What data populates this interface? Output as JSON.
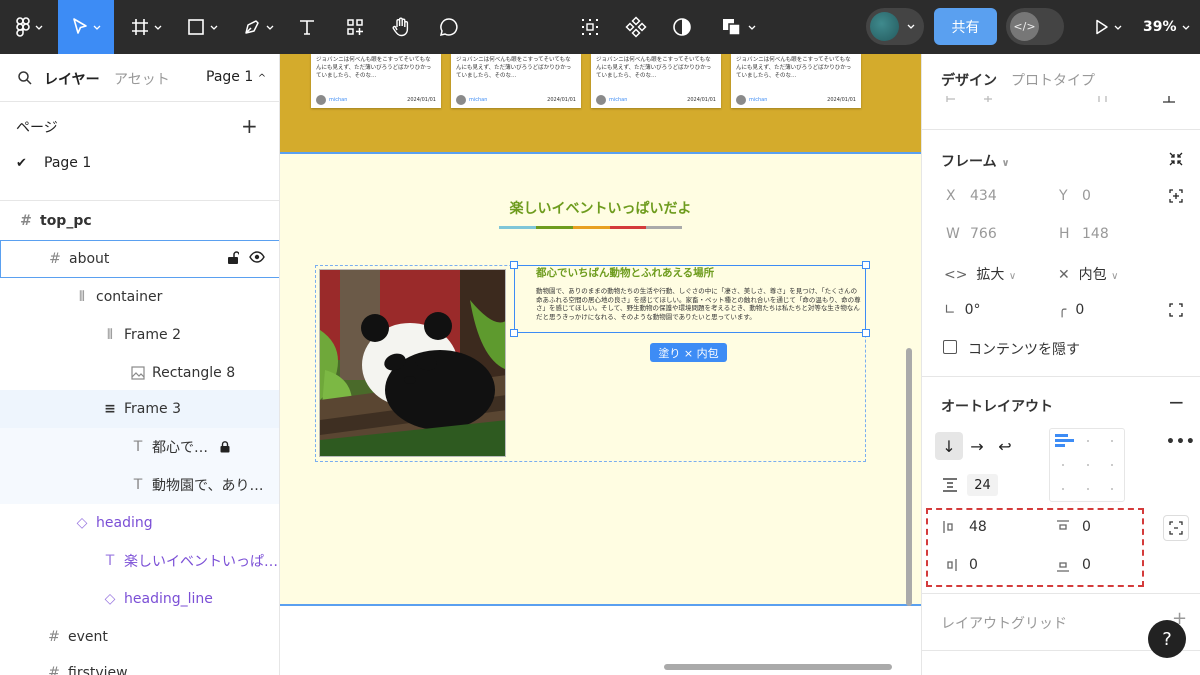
{
  "toolbar": {
    "share_label": "共有",
    "zoom_label": "39%",
    "accent": "#3d8cf5",
    "icons": [
      "figma-menu-icon",
      "move-tool-icon",
      "frame-tool-icon",
      "shape-tool-icon",
      "pen-tool-icon",
      "text-tool-icon",
      "component-tool-icon",
      "hand-tool-icon",
      "comment-tool-icon",
      "grid-icon",
      "component-icon",
      "mask-icon",
      "boolean-icon",
      "play-icon"
    ]
  },
  "left_panel": {
    "tab_layers": "レイヤー",
    "tab_assets": "アセット",
    "page_selector": "Page 1",
    "pages_header": "ページ",
    "pages": [
      "Page 1"
    ],
    "layers": [
      {
        "name": "top_pc",
        "icon": "frame-icon"
      },
      {
        "name": "about",
        "icon": "frame-icon"
      },
      {
        "name": "container",
        "icon": "auto-layout-icon"
      },
      {
        "name": "Frame 2",
        "icon": "auto-layout-icon"
      },
      {
        "name": "Rectangle 8",
        "icon": "image-icon"
      },
      {
        "name": "Frame 3",
        "icon": "auto-layout-vertical-icon"
      },
      {
        "name": "都心で…",
        "icon": "text-icon"
      },
      {
        "name": "動物園で、あり…",
        "icon": "text-icon"
      },
      {
        "name": "heading",
        "icon": "component-instance-icon"
      },
      {
        "name": "楽しいイベントいっぱ…",
        "icon": "text-icon"
      },
      {
        "name": "heading_line",
        "icon": "component-instance-icon"
      },
      {
        "name": "event",
        "icon": "frame-icon"
      },
      {
        "name": "firstview",
        "icon": "frame-icon"
      }
    ]
  },
  "canvas": {
    "cards": [
      {
        "text": "ジョバンニは何べんも眼をこすってそいてもなんにも見えず、ただ薄いびろうどばかりひかっていましたら、そのな…",
        "author": "michan",
        "date": "2024/01/01"
      },
      {
        "text": "ジョバンニは何べんも眼をこすってそいてもなんにも見えず、ただ薄いびろうどばかりひかっていましたら、そのな…",
        "author": "michan",
        "date": "2024/01/01"
      },
      {
        "text": "ジョバンニは何べんも眼をこすってそいてもなんにも見えず、ただ薄いびろうどばかりひかっていましたら、そのな…",
        "author": "michan",
        "date": "2024/01/01"
      },
      {
        "text": "ジョバンニは何べんも眼をこすってそいてもなんにも見えず、ただ薄いびろうどばかりひかっていましたら、そのな…",
        "author": "michan",
        "date": "2024/01/01"
      }
    ],
    "section_title": "楽しいイベントいっぱいだよ",
    "heading_line_colors": [
      "#7fc6d8",
      "#6e9c1e",
      "#e8a020",
      "#d43b3b",
      "#aaaaaa"
    ],
    "about_title": "都心でいちばん動物とふれあえる場所",
    "about_body": "動物園で、ありのままの動物たちの生活や行動、しぐさの中に「凄さ、美しさ、尊さ」を見つけ、「たくさんの命あふれる空間の居心地の良さ」を感じてほしい。家畜・ペット種との触れ合いを通じて「命の温もり、命の尊さ」を感じてほしい。そして、野生動物の保護や環境問題を考えるとき、動物たちは私たちと対等な生き物なんだと思うきっかけになれる、そのような動物園でありたいと思っています。",
    "size_badge": "塗り × 内包",
    "colors": {
      "band": "#d4ab2c",
      "cream": "#fffde2",
      "title_green": "#6e9c1e"
    }
  },
  "right_panel": {
    "tab_design": "デザイン",
    "tab_prototype": "プロトタイプ",
    "frame_header": "フレーム",
    "x_label": "X",
    "x_value": "434",
    "y_label": "Y",
    "y_value": "0",
    "w_label": "W",
    "w_value": "766",
    "h_label": "H",
    "h_value": "148",
    "width_mode": "拡大",
    "height_mode": "内包",
    "rotation": "0°",
    "radius": "0",
    "clip_content_label": "コンテンツを隠す",
    "auto_layout_header": "オートレイアウト",
    "gap": "24",
    "padding_left": "48",
    "padding_top": "0",
    "padding_right": "0",
    "padding_bottom": "0",
    "layout_grid_header": "レイアウトグリッド",
    "help_label": "?"
  }
}
